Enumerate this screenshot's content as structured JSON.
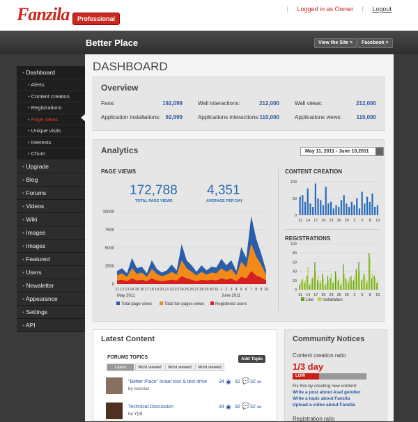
{
  "brand": {
    "logo": "Fanzila",
    "badge": "Professional"
  },
  "top": {
    "login": "Logged in as Owner",
    "logout": "Logout",
    "sep": "|"
  },
  "header": {
    "site": "Better Place",
    "view": "View the Site >",
    "fb": "Facebook >"
  },
  "sidebar": {
    "dashboard": "Dashboard",
    "subs": [
      "Alerts",
      "Content creation",
      "Registrations",
      "Page views",
      "Unique visits",
      "Interests",
      "Churn"
    ],
    "items": [
      "Upgrade",
      "Blog",
      "Forums",
      "Videos",
      "Wiki",
      "Images",
      "Images",
      "Featured",
      "Users",
      "Newsletter",
      "Appearance",
      "Settings",
      "API"
    ]
  },
  "page": {
    "title": "DASHBOARD"
  },
  "overview": {
    "title": "Overview",
    "rows": [
      [
        {
          "l": "Fans:",
          "v": "192,099"
        },
        {
          "l": "Wall interactions:",
          "v": "212,000"
        },
        {
          "l": "Wall views:",
          "v": "212,000"
        }
      ],
      [
        {
          "l": "Application installations:",
          "v": "92,999"
        },
        {
          "l": "Applications interactions:",
          "v": "110,000"
        },
        {
          "l": "Applications views:",
          "v": "110,000"
        }
      ]
    ]
  },
  "analytics": {
    "title": "Analytics",
    "range": "May 11, 2011 - June 10,2011",
    "pv": "PAGE VIEWS",
    "total": "172,788",
    "total_cap": "TOTAL PAGE VIEWS",
    "avg": "4,351",
    "avg_cap": "AVERAGE PER DAY",
    "cc": "CONTENT CREATION",
    "reg": "REGISTRATIONS",
    "month1": "May 2011",
    "month2": "June 2011",
    "legend": [
      "Total page views",
      "Total fan pages views",
      "Registered users"
    ],
    "legend2": [
      "Like",
      "Installation"
    ]
  },
  "latest": {
    "title": "Latest Content",
    "forums": "FORUMS TOPICS",
    "add": "Add Topic",
    "tabs": [
      "Latest",
      "Most viewed",
      "Most viewed",
      "Most viewed"
    ],
    "items": [
      {
        "t": "\"Better Place\" Israel tour & test drive",
        "by": "by esoniat",
        "a": "34",
        "b": "32"
      },
      {
        "t": "Technical Discussion",
        "by": "by Y||B",
        "a": "34",
        "b": "32"
      }
    ]
  },
  "notices": {
    "title": "Community Notices",
    "ratio": "Content creation ratio",
    "days": "1/3 day",
    "low": "LOW",
    "fix": "Fix this by creating new content:",
    "l1": "Write a post about Asaf gendler",
    "l2": "Write a topic about Fanzila",
    "l3": "Upload a video about Fanzila",
    "reg": "Registration ratio"
  },
  "chart_data": [
    {
      "type": "area",
      "title": "PAGE VIEWS",
      "x": [
        "11",
        "12",
        "13",
        "14",
        "15",
        "16",
        "17",
        "18",
        "19",
        "20",
        "21",
        "22",
        "23",
        "24",
        "25",
        "26",
        "27",
        "28",
        "29",
        "30",
        "31",
        "1",
        "2",
        "3",
        "4",
        "5",
        "6",
        "7",
        "8",
        "9",
        "10"
      ],
      "ylim": [
        0,
        10000
      ],
      "yticks": [
        0,
        2500,
        5000,
        7500,
        10000
      ],
      "series": [
        {
          "name": "Total page views",
          "values": [
            1800,
            2200,
            1500,
            3600,
            2200,
            2400,
            1500,
            3300,
            2100,
            1600,
            1900,
            2700,
            1900,
            5500,
            3300,
            2600,
            1700,
            2600,
            1900,
            2400,
            2300,
            3500,
            2600,
            3300,
            1800,
            5100,
            3600,
            9400,
            6300,
            4200,
            1900
          ]
        },
        {
          "name": "Total fan pages views",
          "values": [
            1200,
            1500,
            1000,
            2200,
            1400,
            1600,
            1000,
            2100,
            1400,
            1100,
            1300,
            1700,
            1300,
            3300,
            2200,
            1700,
            1200,
            1700,
            1300,
            1600,
            1500,
            2200,
            1700,
            2100,
            1200,
            3100,
            2300,
            5600,
            3800,
            2700,
            1300
          ]
        },
        {
          "name": "Registered users",
          "values": [
            500,
            600,
            400,
            800,
            500,
            600,
            400,
            800,
            500,
            400,
            500,
            600,
            500,
            1100,
            800,
            600,
            400,
            600,
            500,
            600,
            500,
            800,
            600,
            800,
            400,
            1000,
            800,
            1800,
            1200,
            900,
            500
          ]
        }
      ]
    },
    {
      "type": "bar",
      "title": "CONTENT CREATION",
      "ylim": [
        0,
        100
      ],
      "yticks": [
        0,
        50,
        100
      ],
      "x": [
        "11",
        "14",
        "17",
        "20",
        "23",
        "26",
        "29",
        "2",
        "5",
        "8",
        "10"
      ],
      "values": [
        55,
        60,
        40,
        80,
        35,
        25,
        95,
        50,
        45,
        30,
        85,
        35,
        40,
        20,
        30,
        25,
        45,
        60,
        35,
        25,
        40,
        30,
        50,
        20,
        70,
        35,
        55,
        40,
        65,
        25,
        30
      ]
    },
    {
      "type": "bar",
      "title": "REGISTRATIONS",
      "ylim": [
        0,
        100
      ],
      "yticks": [
        0,
        20,
        40,
        60,
        80,
        100
      ],
      "x": [
        "11",
        "14",
        "17",
        "20",
        "23",
        "26",
        "29",
        "2",
        "5",
        "8",
        "10"
      ],
      "series": [
        {
          "name": "Like",
          "values": [
            10,
            20,
            15,
            30,
            10,
            25,
            60,
            20,
            15,
            35,
            10,
            30,
            25,
            15,
            40,
            20,
            10,
            55,
            25,
            15,
            30,
            20,
            45,
            60,
            20,
            35,
            15,
            80,
            25,
            30,
            15
          ]
        },
        {
          "name": "Installation",
          "values": [
            15,
            25,
            20,
            50,
            15,
            30,
            40,
            30,
            20,
            25,
            15,
            20,
            35,
            20,
            30,
            25,
            15,
            35,
            20,
            25,
            20,
            30,
            35,
            40,
            25,
            30,
            20,
            70,
            35,
            25,
            20
          ]
        }
      ]
    }
  ]
}
